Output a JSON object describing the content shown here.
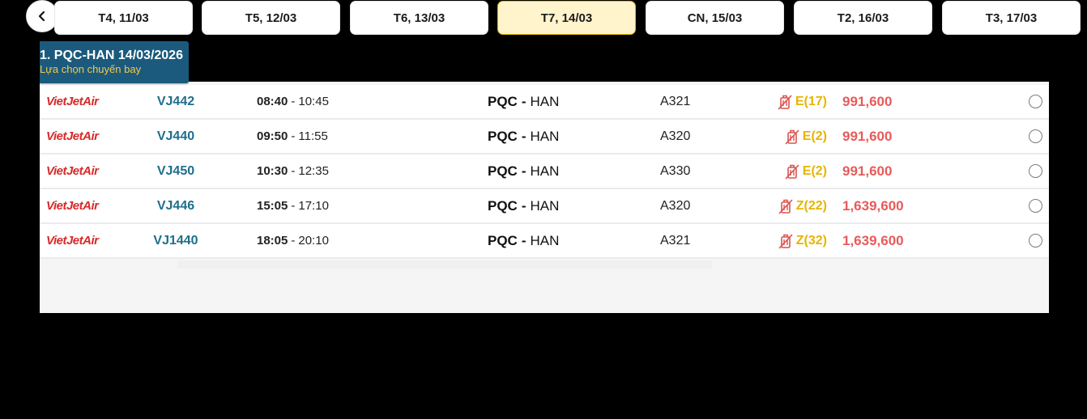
{
  "date_tabs": [
    {
      "label": "T4, 11/03",
      "active": false
    },
    {
      "label": "T5, 12/03",
      "active": false
    },
    {
      "label": "T6, 13/03",
      "active": false
    },
    {
      "label": "T7, 14/03",
      "active": true
    },
    {
      "label": "CN, 15/03",
      "active": false
    },
    {
      "label": "T2, 16/03",
      "active": false
    },
    {
      "label": "T3, 17/03",
      "active": false
    }
  ],
  "route_banner": {
    "title": "1. PQC-HAN 14/03/2026",
    "subtitle": "Lựa chọn chuyến bay"
  },
  "flights": [
    {
      "airline": "VietJetAir",
      "flight_no": "VJ442",
      "dep": "08:40",
      "arr": "10:45",
      "from": "PQC",
      "to": "HAN",
      "aircraft": "A321",
      "fare_class": "E(17)",
      "price": "991,600"
    },
    {
      "airline": "VietJetAir",
      "flight_no": "VJ440",
      "dep": "09:50",
      "arr": "11:55",
      "from": "PQC",
      "to": "HAN",
      "aircraft": "A320",
      "fare_class": "E(2)",
      "price": "991,600"
    },
    {
      "airline": "VietJetAir",
      "flight_no": "VJ450",
      "dep": "10:30",
      "arr": "12:35",
      "from": "PQC",
      "to": "HAN",
      "aircraft": "A330",
      "fare_class": "E(2)",
      "price": "991,600"
    },
    {
      "airline": "VietJetAir",
      "flight_no": "VJ446",
      "dep": "15:05",
      "arr": "17:10",
      "from": "PQC",
      "to": "HAN",
      "aircraft": "A320",
      "fare_class": "Z(22)",
      "price": "1,639,600"
    },
    {
      "airline": "VietJetAir",
      "flight_no": "VJ1440",
      "dep": "18:05",
      "arr": "20:10",
      "from": "PQC",
      "to": "HAN",
      "aircraft": "A321",
      "fare_class": "Z(32)",
      "price": "1,639,600"
    }
  ],
  "colors": {
    "active_tab_bg": "#fff4cc",
    "banner_bg": "#1b5a7d",
    "flight_no": "#1f6e8c",
    "price": "#e85a5a",
    "fare_class": "#e8b400",
    "airline_logo": "#d62a2a"
  },
  "icons": {
    "prev": "chevron-left-icon",
    "baggage": "no-baggage-icon",
    "select": "radio-icon"
  }
}
